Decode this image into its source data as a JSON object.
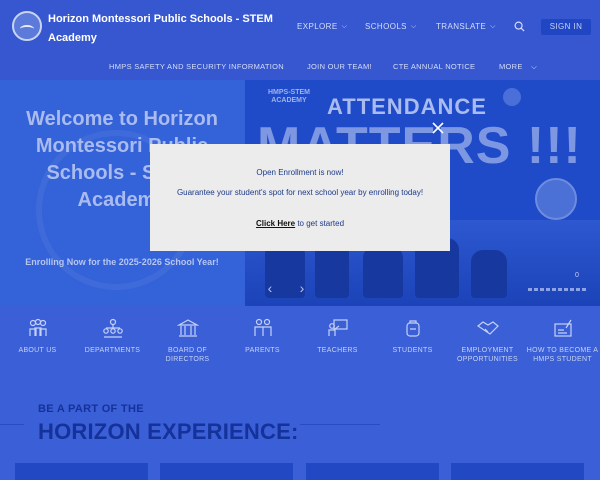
{
  "header": {
    "title": "Horizon Montessori Public Schools - STEM Academy",
    "nav": [
      {
        "label": "EXPLORE"
      },
      {
        "label": "SCHOOLS"
      },
      {
        "label": "TRANSLATE"
      }
    ],
    "sign_in": "SIGN IN",
    "sub_nav": [
      {
        "label": "HMPS SAFETY AND SECURITY INFORMATION"
      },
      {
        "label": "JOIN OUR TEAM!"
      },
      {
        "label": "CTE ANNUAL NOTICE"
      },
      {
        "label": "MORE"
      }
    ]
  },
  "hero": {
    "welcome": "Welcome to Horizon Montessori Public Schools - STEM Academy",
    "enrolling": "Enrolling Now for the 2025-2026 School Year!",
    "slide_tag": "HMPS-STEM ACADEMY",
    "slide_heading": "ATTENDANCE",
    "slide_big": "MATTERS !!!",
    "slide_number": "0"
  },
  "quick_links": [
    {
      "label": "ABOUT US",
      "icon": "people-group-icon"
    },
    {
      "label": "DEPARTMENTS",
      "icon": "org-chart-icon"
    },
    {
      "label": "BOARD OF DIRECTORS",
      "icon": "building-icon"
    },
    {
      "label": "PARENTS",
      "icon": "parents-icon"
    },
    {
      "label": "TEACHERS",
      "icon": "teacher-board-icon"
    },
    {
      "label": "STUDENTS",
      "icon": "student-backpack-icon"
    },
    {
      "label": "EMPLOYMENT OPPORTUNITIES",
      "icon": "handshake-icon"
    },
    {
      "label": "HOW TO BECOME A HMPS STUDENT",
      "icon": "form-pencil-icon"
    }
  ],
  "experience": {
    "kicker": "BE A PART OF THE",
    "title": "HORIZON EXPERIENCE:"
  },
  "modal": {
    "line1": "Open Enrollment is now!",
    "line2": "Guarantee your student's spot for next school year by enrolling today!",
    "link": "Click Here",
    "link_suffix": " to get started"
  },
  "colors": {
    "overlay_blue": "#3a5fd6",
    "modal_bg": "#ececec",
    "heading_blue": "#14329a"
  }
}
